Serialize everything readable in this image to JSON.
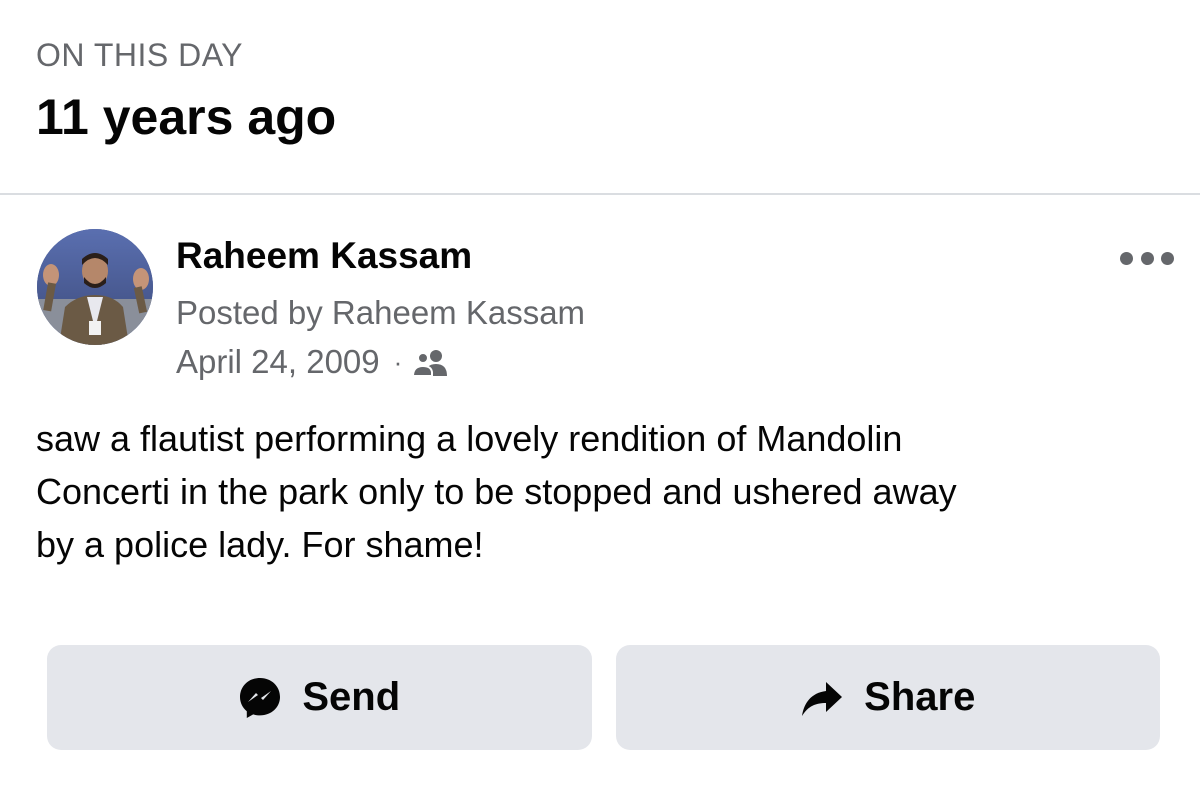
{
  "memory": {
    "section_label": "ON THIS DAY",
    "time_ago": "11 years ago"
  },
  "post": {
    "author_name": "Raheem Kassam",
    "posted_by": "Posted by Raheem Kassam",
    "date": "April 24, 2009",
    "separator": "·",
    "audience_icon": "friends-icon",
    "text": "saw a flautist performing a lovely rendition of Mandolin\nConcerti in the park only to be stopped and ushered away\nby a police lady.  For shame!"
  },
  "actions": {
    "send_label": "Send",
    "send_icon": "messenger-icon",
    "share_label": "Share",
    "share_icon": "share-arrow-icon"
  },
  "colors": {
    "secondary_text": "#65676b",
    "button_bg": "#e4e6eb",
    "divider": "#dadde1"
  }
}
